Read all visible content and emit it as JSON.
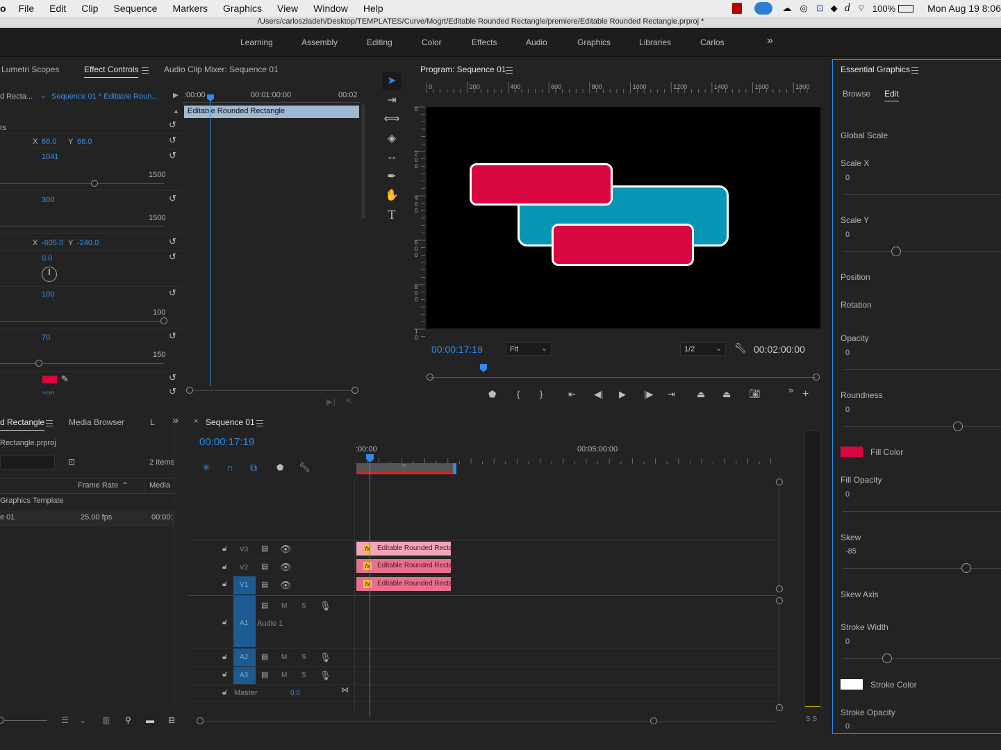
{
  "menubar": {
    "app_initial": "o",
    "items": [
      "File",
      "Edit",
      "Clip",
      "Sequence",
      "Markers",
      "Graphics",
      "View",
      "Window",
      "Help"
    ],
    "battery": "100%",
    "datetime": "Mon Aug 19  8:06"
  },
  "title_path": "/Users/carlosziadeh/Desktop/TEMPLATES/Curve/Mogrt/Editable Rounded Rectangle/premiere/Editable Rounded Rectangle.prproj *",
  "workspaces": {
    "items": [
      "Learning",
      "Assembly",
      "Editing",
      "Color",
      "Effects",
      "Audio",
      "Graphics",
      "Libraries",
      "Carlos"
    ],
    "active": "Graphics",
    "more": "»"
  },
  "effect_panel": {
    "tabs": [
      "Lumetri Scopes",
      "Effect Controls",
      "Audio Clip Mixer: Sequence 01"
    ],
    "source_clip": "d Recta...",
    "sequence_clip": "Sequence 01 * Editable Roun...",
    "ruler": {
      "start": ":00:00",
      "mid": "00:01:00:00",
      "end": "00:02"
    },
    "clip_bar_label": "Editable Rounded Rectangle",
    "row_label": "rs",
    "props": {
      "x1": "66.0",
      "y1": "66.0",
      "v1041": "1041",
      "max1500a": "1500",
      "v300": "300",
      "max1500b": "1500",
      "x2": "-605.0",
      "y2": "-240.0",
      "rot": "0.0",
      "v100": "100",
      "max100": "100",
      "v70": "70",
      "max150": "150",
      "x_label": "X",
      "y_label": "Y",
      "last_value": "100"
    }
  },
  "program": {
    "title": "Program: Sequence 01",
    "ruler_labels": [
      "0",
      "200",
      "400",
      "600",
      "800",
      "1000",
      "1200",
      "1400",
      "1600",
      "1800"
    ],
    "vruler_labels": [
      "0",
      "200",
      "400",
      "600",
      "800",
      "1000"
    ],
    "timecode": "00:00:17:19",
    "fit": "Fit",
    "resolution": "1/2",
    "duration": "00:02:00:00",
    "colors": {
      "red": "#d8073f",
      "teal": "#0796b6",
      "stroke": "#ffffff"
    }
  },
  "project": {
    "tabs": [
      "d Rectangle",
      "Media Browser",
      "L"
    ],
    "file": "Rectangle.prproj",
    "items_count": "2 Items",
    "col_frame_rate": "Frame Rate",
    "col_media": "Media",
    "rows": [
      {
        "name": "Graphics Template",
        "fps": "",
        "media": ""
      },
      {
        "name": "e 01",
        "fps": "25.00 fps",
        "media": "00:00:"
      }
    ]
  },
  "timeline": {
    "title": "Sequence 01",
    "timecode": "00:00:17:19",
    "ruler_start": ":00:00",
    "ruler_mid": "00:05:00:00",
    "tracks": [
      {
        "id": "V3",
        "clip": "Editable Rounded Recta"
      },
      {
        "id": "V2",
        "clip": "Editable Rounded Rectan"
      },
      {
        "id": "V1",
        "clip": "Editable Rounded Rectan"
      }
    ],
    "audio": [
      {
        "id": "A1",
        "name": "Audio 1"
      },
      {
        "id": "A2",
        "name": ""
      },
      {
        "id": "A3",
        "name": ""
      }
    ],
    "master": "Master",
    "master_val": "0.0",
    "m": "M",
    "s": "S",
    "clip_marker": "III",
    "meter": "S S"
  },
  "essential": {
    "title": "Essential Graphics",
    "tabs": [
      "Browse",
      "Edit"
    ],
    "active_tab": "Edit",
    "global_scale": "Global Scale",
    "scale_x": "Scale X",
    "scale_x_val": "0",
    "scale_y": "Scale Y",
    "scale_y_val": "0",
    "position": "Position",
    "rotation": "Rotation",
    "opacity": "Opacity",
    "opacity_val": "0",
    "roundness": "Roundness",
    "roundness_val": "0",
    "fill_color": "Fill Color",
    "fill_hex": "#d8073f",
    "fill_opacity": "Fill Opacity",
    "fill_opacity_val": "0",
    "skew": "Skew",
    "skew_val": "-85",
    "skew_axis": "Skew Axis",
    "stroke_width": "Stroke Width",
    "stroke_width_val": "0",
    "stroke_color": "Stroke Color",
    "stroke_hex": "#ffffff",
    "stroke_opacity": "Stroke Opacity",
    "stroke_opacity_val": "0"
  }
}
